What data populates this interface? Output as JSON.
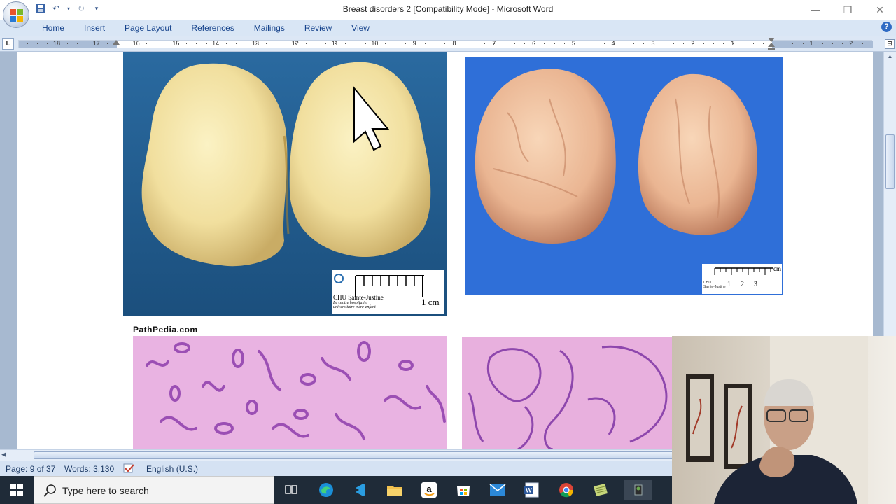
{
  "window": {
    "title": "Breast disorders 2 [Compatibility Mode] - Microsoft Word",
    "controls": [
      "minimize",
      "restore",
      "close"
    ]
  },
  "ribbon": {
    "tabs": [
      "Home",
      "Insert",
      "Page Layout",
      "References",
      "Mailings",
      "Review",
      "View"
    ],
    "tab_selector": "L"
  },
  "ruler": {
    "labels": [
      "18",
      "17",
      "16",
      "15",
      "14",
      "13",
      "12",
      "11",
      "10",
      "9",
      "8",
      "7",
      "6",
      "5",
      "4",
      "3",
      "2",
      "1",
      "1",
      "2"
    ]
  },
  "document": {
    "images": [
      {
        "name": "gross-specimen-left",
        "caption_line1": "CHU Sainte-Justine",
        "caption_line2": "Le centre hospitalier",
        "caption_line3": "universitaire mère-enfant",
        "scale_label": "1 cm"
      },
      {
        "name": "gross-specimen-right",
        "caption_line1": "CHU",
        "caption_line2": "Sainte-Justine",
        "scale_unit": "cm",
        "scale_numbers": [
          "1",
          "2",
          "3"
        ]
      },
      {
        "name": "histology-left",
        "watermark": "PathPedia.com"
      },
      {
        "name": "histology-right"
      }
    ]
  },
  "statusbar": {
    "page": "Page: 9 of 37",
    "words": "Words: 3,130",
    "language": "English (U.S.)"
  },
  "taskbar": {
    "search_placeholder": "Type here to search",
    "icons": [
      "task-view-icon",
      "edge-icon",
      "visual-studio-icon",
      "file-explorer-icon",
      "amazon-icon",
      "store-icon",
      "mail-icon",
      "word-icon",
      "chrome-icon",
      "excel-like-icon",
      "app-icon"
    ]
  },
  "colors": {
    "ribbon": "#d9e6f5",
    "tab_text": "#15428b",
    "doc_background": "#a7b9d0",
    "taskbar": "#1f2b38",
    "gross_bg_left": "#1f5c8e",
    "gross_bg_right": "#2e6fd6",
    "histology_pink": "#e6aee0"
  }
}
